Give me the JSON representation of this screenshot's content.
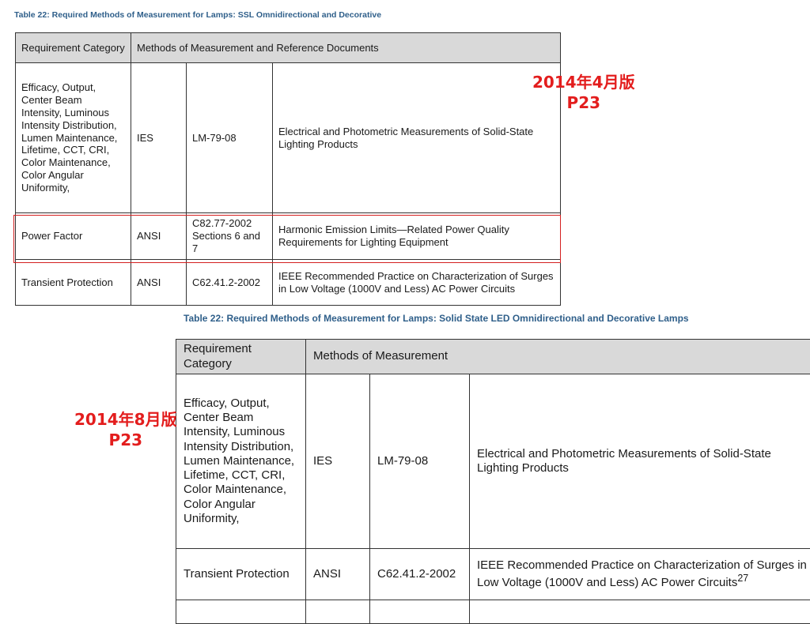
{
  "table1": {
    "caption": "Table 22: Required Methods of Measurement for Lamps: SSL Omnidirectional and Decorative",
    "header": {
      "col1": "Requirement Category",
      "col2": "Methods of Measurement and Reference Documents"
    },
    "rows": [
      {
        "category": "Efficacy, Output, Center Beam Intensity, Luminous Intensity Distribution, Lumen Maintenance, Lifetime, CCT, CRI, Color Maintenance, Color Angular Uniformity,",
        "org": "IES",
        "doc": "LM-79-08",
        "title": "Electrical and Photometric Measurements of Solid-State Lighting Products"
      },
      {
        "category": "Power Factor",
        "org": "ANSI",
        "doc": "C82.77-2002 Sections 6 and 7",
        "title": "Harmonic Emission Limits—Related Power Quality Requirements for Lighting Equipment"
      },
      {
        "category": "Transient Protection",
        "org": "ANSI",
        "doc": "C62.41.2-2002",
        "title": "IEEE Recommended Practice on Characterization of Surges in Low Voltage (1000V and Less) AC Power Circuits"
      }
    ]
  },
  "table2": {
    "caption": "Table 22: Required Methods of Measurement for Lamps: Solid State LED Omnidirectional and Decorative Lamps",
    "header": {
      "col1": "Requirement Category",
      "col2": "Methods of Measurement"
    },
    "rows": [
      {
        "category": "Efficacy, Output, Center Beam Intensity, Luminous Intensity Distribution, Lumen Maintenance, Lifetime, CCT, CRI, Color Maintenance, Color Angular Uniformity,",
        "org": "IES",
        "doc": "LM-79-08",
        "title": "Electrical and Photometric Measurements of Solid-State Lighting Products"
      },
      {
        "category": "Transient Protection",
        "org": "ANSI",
        "doc": "C62.41.2-2002",
        "title": "IEEE Recommended Practice on Characterization of Surges in Low Voltage (1000V and Less) AC Power Circuits",
        "footnote": "27"
      }
    ]
  },
  "annotations": {
    "april": {
      "line1": "2014年4月版",
      "line2": "P23"
    },
    "august": {
      "line1": "2014年8月版",
      "line2": "P23"
    }
  },
  "colors": {
    "annotation_red": "#e31d1d",
    "highlight_border": "#d42020",
    "caption_blue": "#2f5f8a",
    "header_gray": "#d9d9d9"
  }
}
